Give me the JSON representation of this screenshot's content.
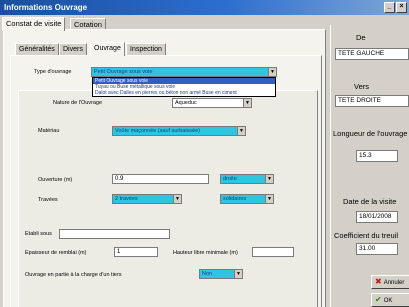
{
  "window": {
    "title": "Informations Ouvrage"
  },
  "outer_tabs": [
    {
      "label": "Constat de visite"
    },
    {
      "label": "Cotation"
    }
  ],
  "inner_tabs": [
    {
      "label": "Généralités"
    },
    {
      "label": "Divers"
    },
    {
      "label": "Ouvrage"
    },
    {
      "label": "Inspection"
    }
  ],
  "form": {
    "type_ouvrage": {
      "label": "Type d'ouvrage",
      "value": "Petit Ouvrage sous voie"
    },
    "dropdown_options": [
      "Petit Ouvrage sous voie",
      "Tuyau ou Buse métallique sous voie",
      "Dalot avec Dalles en pierres ou béton non armé Buse en ciment"
    ],
    "nature": {
      "label": "Nature de l'Ouvrage",
      "value": "Aqueduc"
    },
    "materiau": {
      "label": "Matériau",
      "value": "Voûte maçonnée (sauf surbaissée)"
    },
    "ouverture": {
      "label": "Ouverture (m)",
      "value": "0.9",
      "shape": "droite"
    },
    "travees": {
      "label": "Travées",
      "value": "2 travées",
      "type": "solidaires"
    },
    "etabli_sous": {
      "label": "Etabli sous",
      "value": ""
    },
    "epaisseur": {
      "label": "Epaisseur de remblai (m)",
      "value": "1"
    },
    "hauteur_libre": {
      "label": "Hauteur libre minimale (m)",
      "value": ""
    },
    "charge_tiers": {
      "label": "Ouvrage en partie à la charge d'un tiers",
      "value": "Non"
    }
  },
  "right_panel": {
    "de_label": "De",
    "de_value": "TETE GAUCHE",
    "vers_label": "Vers",
    "vers_value": "TETE DROITE",
    "longueur_label": "Longueur de l'ouvrage",
    "longueur_value": "15.3",
    "date_label": "Date de la visite",
    "date_value": "18/01/2008",
    "coef_label": "Coefficient du treuil",
    "coef_value": "31.00",
    "annuler_label": "Annuler",
    "ok_label": "OK"
  },
  "colors": {
    "title_bar": "#1a4f9e",
    "selection": "#2fc4e0",
    "highlight": "#2f5fc0"
  }
}
